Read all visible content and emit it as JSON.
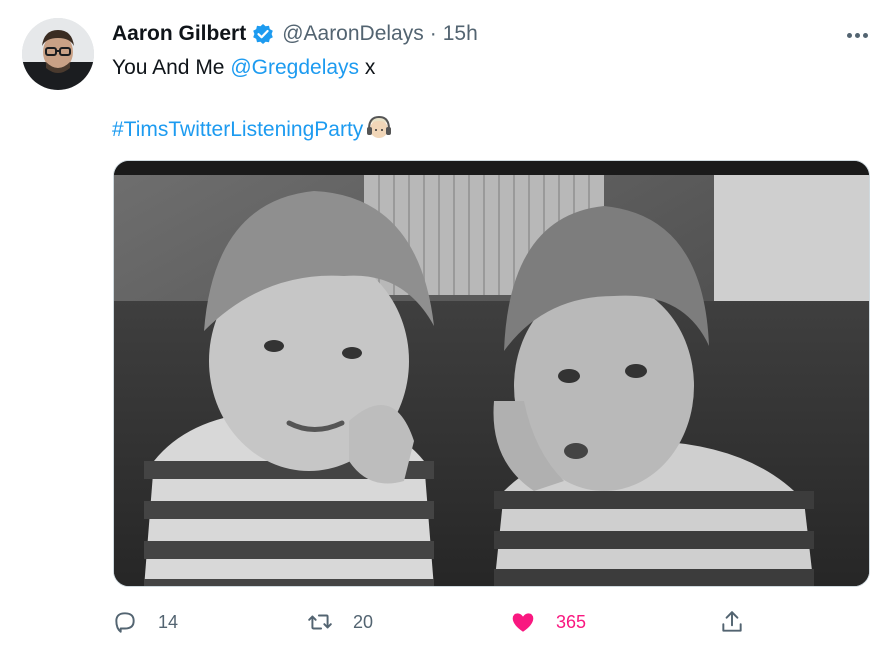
{
  "tweet": {
    "author_name": "Aaron Gilbert",
    "handle": "@AaronDelays",
    "separator": "·",
    "time": "15h",
    "text_prefix": "You And Me ",
    "mention": "@Gregdelays",
    "text_suffix": " x",
    "hashtag": "#TimsTwitterListeningParty"
  },
  "stats": {
    "replies": "14",
    "retweets": "20",
    "likes": "365"
  },
  "colors": {
    "accent": "#1d9bf0",
    "like": "#f91880",
    "muted": "#536471",
    "text": "#0f1419"
  },
  "icons": {
    "verified": "verified-badge-icon",
    "more": "more-icon",
    "reply": "reply-icon",
    "retweet": "retweet-icon",
    "like": "heart-icon",
    "share": "share-icon"
  }
}
